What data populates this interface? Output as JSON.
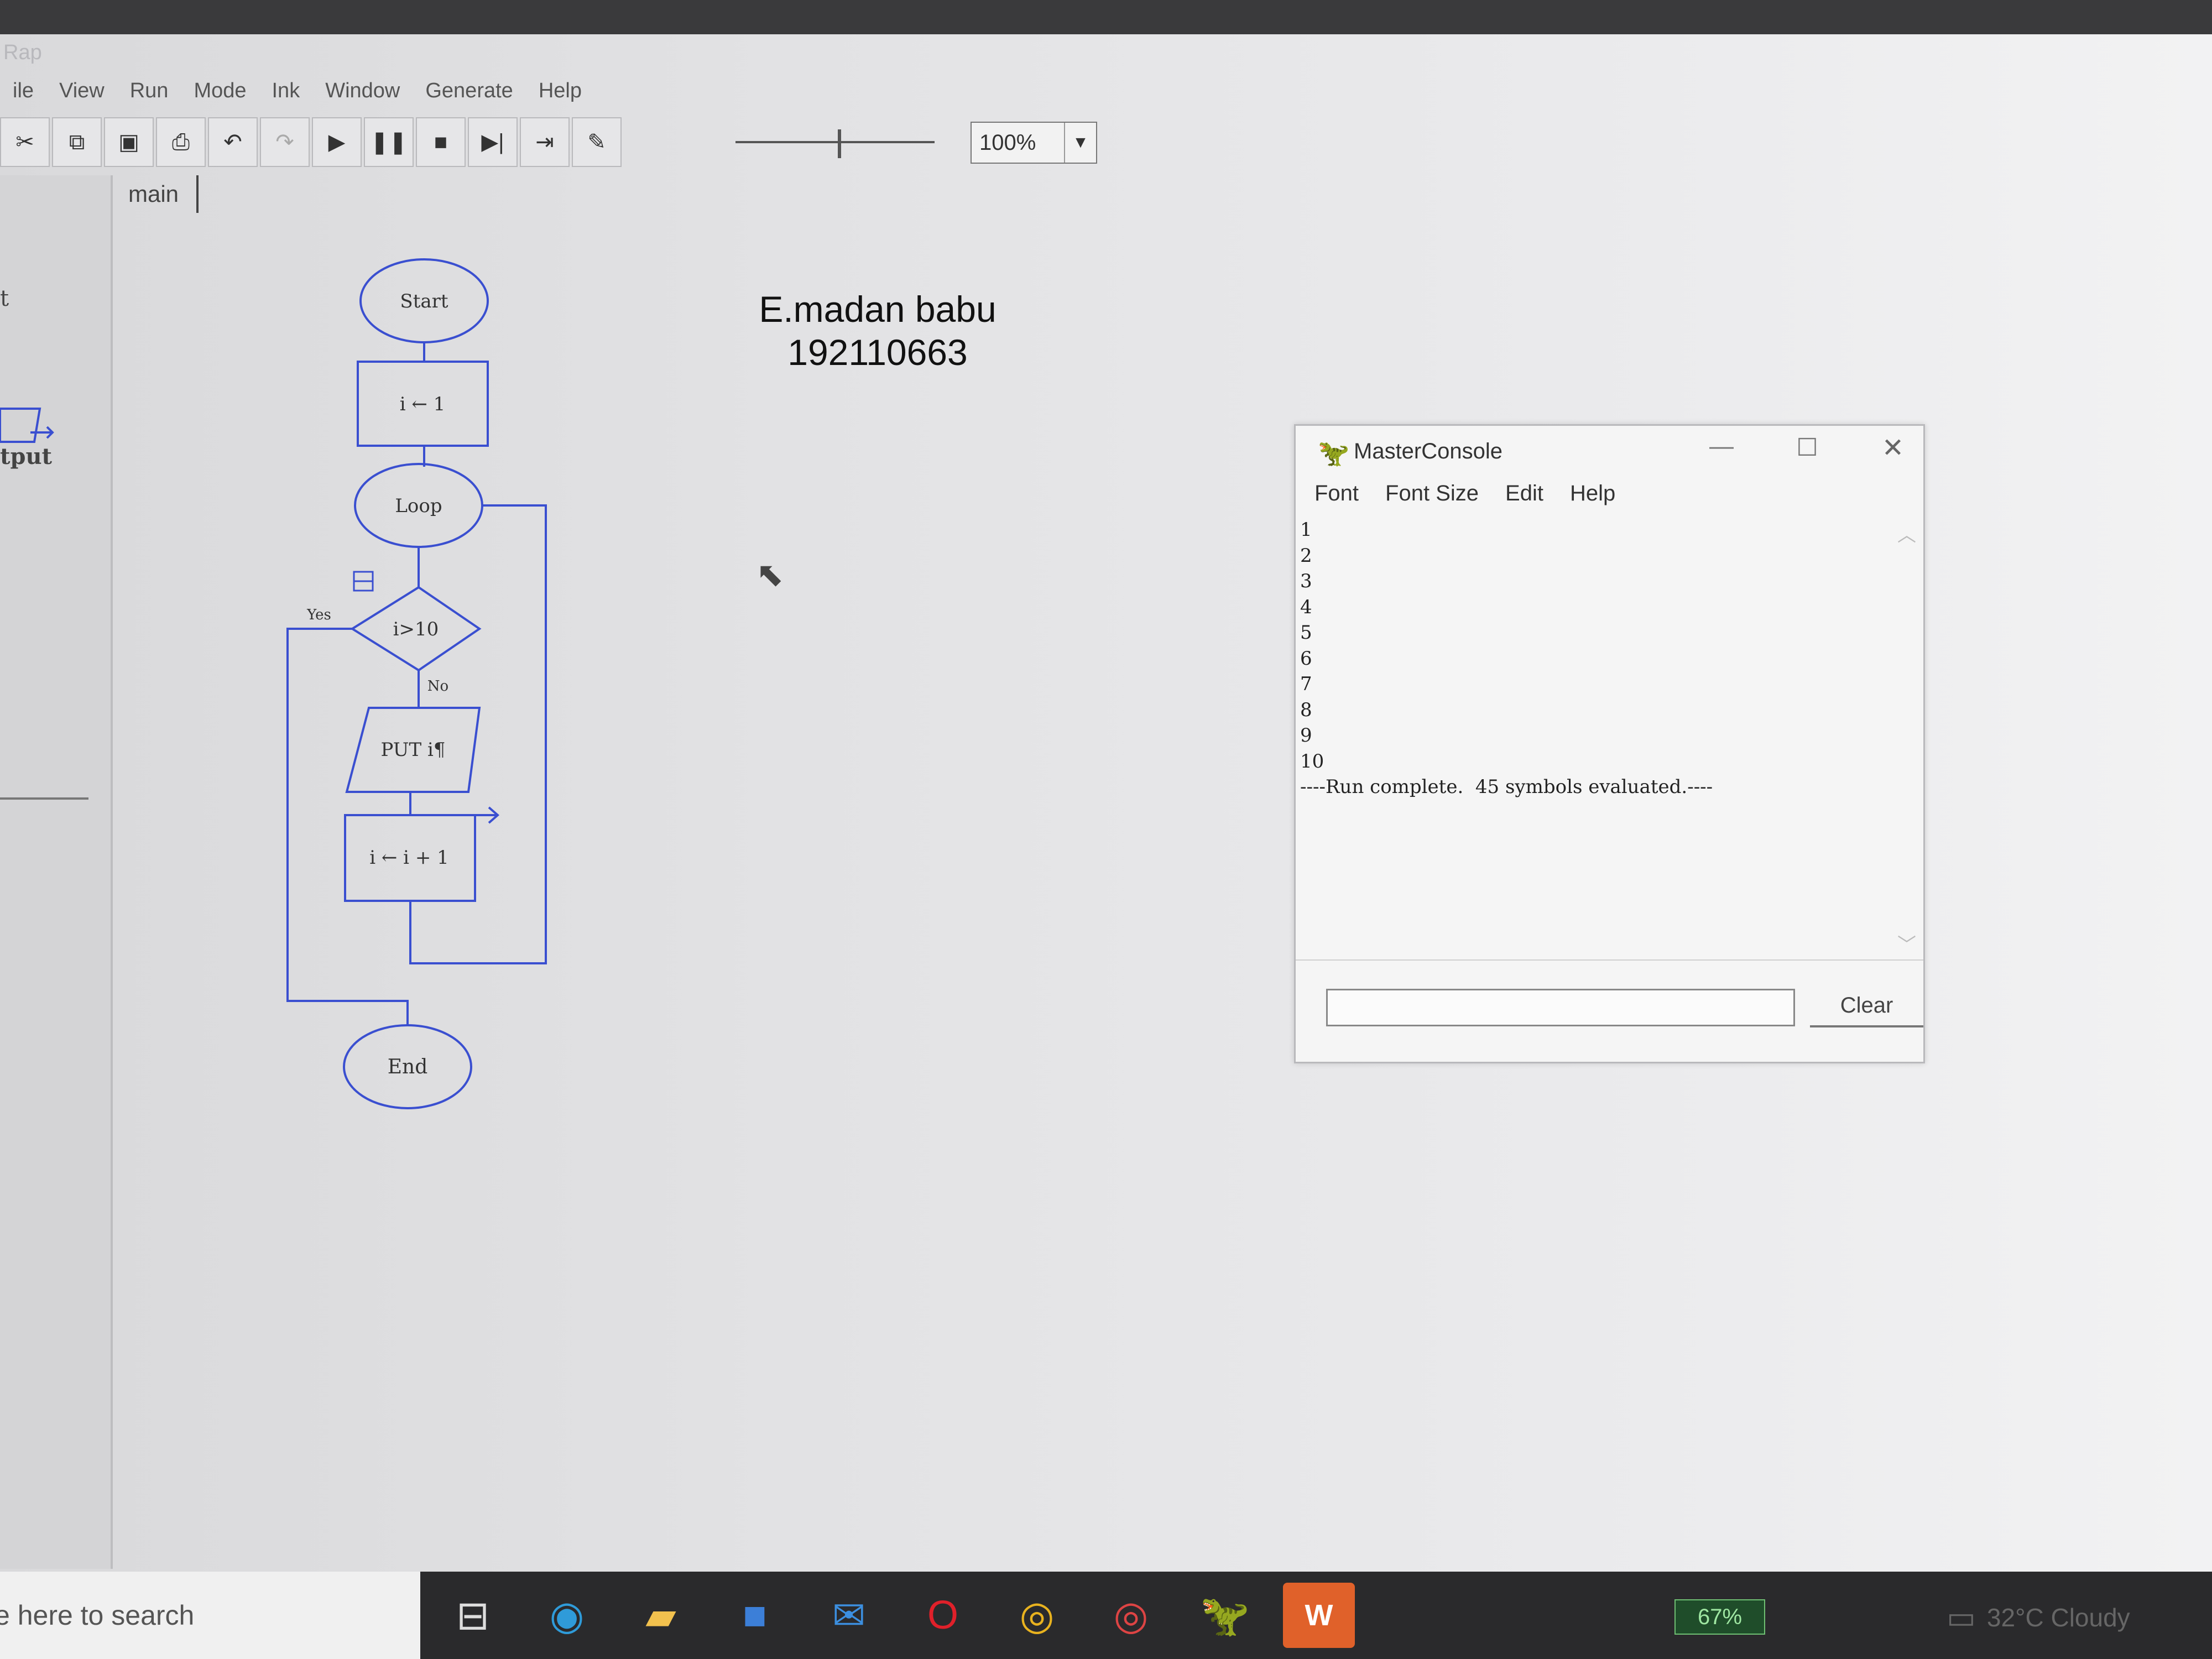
{
  "app": {
    "title": "Rap",
    "menu": [
      "ile",
      "View",
      "Run",
      "Mode",
      "Ink",
      "Window",
      "Generate",
      "Help"
    ],
    "toolbar_buttons": [
      {
        "name": "cut-icon",
        "glyph": "✂"
      },
      {
        "name": "copy-icon",
        "glyph": "⧉"
      },
      {
        "name": "paste-icon",
        "glyph": "▣"
      },
      {
        "name": "print-icon",
        "glyph": "⎙"
      },
      {
        "name": "undo-icon",
        "glyph": "↶"
      },
      {
        "name": "redo-icon",
        "glyph": "↷"
      },
      {
        "name": "play-icon",
        "glyph": "▶"
      },
      {
        "name": "pause-icon",
        "glyph": "❚❚"
      },
      {
        "name": "stop-icon",
        "glyph": "■"
      },
      {
        "name": "step-icon",
        "glyph": "▶|"
      },
      {
        "name": "step-into-icon",
        "glyph": "⇥"
      },
      {
        "name": "pen-icon",
        "glyph": "✎"
      }
    ],
    "zoom": "100%",
    "tab": "main",
    "left_panel": {
      "label_top": "t",
      "label": "tput"
    }
  },
  "flowchart": {
    "start": "Start",
    "assign1": "i ← 1",
    "loop": "Loop",
    "condition": "i>10",
    "yes": "Yes",
    "no": "No",
    "output": "PUT i¶",
    "assign2": "i ← i + 1",
    "end": "End",
    "line_color": "#3a4fd0"
  },
  "author": {
    "name": "E.madan babu",
    "id": "192110663"
  },
  "console": {
    "title": "MasterConsole",
    "menu": [
      "Font",
      "Font Size",
      "Edit",
      "Help"
    ],
    "output": [
      "1",
      "2",
      "3",
      "4",
      "5",
      "6",
      "7",
      "8",
      "9",
      "10",
      "----Run complete.  45 symbols evaluated.----"
    ],
    "input_value": "",
    "clear_label": "Clear"
  },
  "taskbar": {
    "search": "e here to search",
    "apps": [
      "task-view-icon",
      "edge-icon",
      "file-explorer-icon",
      "store-icon",
      "mail-icon",
      "opera-icon",
      "chrome-icon",
      "chrome-profile-icon",
      "raptor-icon",
      "word-icon"
    ],
    "battery": "67%",
    "weather": "32°C  Cloudy"
  }
}
